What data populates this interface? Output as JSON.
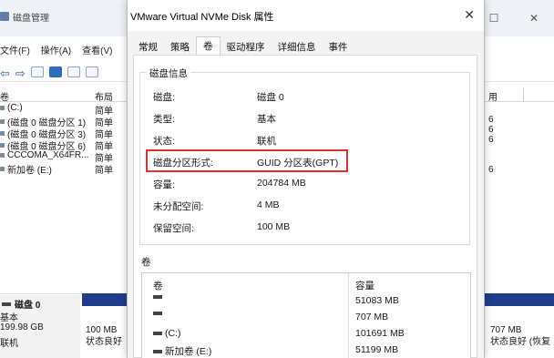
{
  "background_window": {
    "title": "磁盘管理",
    "menu": [
      "文件(F)",
      "操作(A)",
      "查看(V)"
    ],
    "volume_columns": [
      "卷",
      "布局"
    ],
    "volumes": [
      {
        "name": "(C:)",
        "layout": "简单"
      },
      {
        "name": "(磁盘 0 磁盘分区 1)",
        "layout": "简单"
      },
      {
        "name": "(磁盘 0 磁盘分区 3)",
        "layout": "简单"
      },
      {
        "name": "(磁盘 0 磁盘分区 6)",
        "layout": "简单"
      },
      {
        "name": "CCCOMA_X64FR...",
        "layout": "简单"
      },
      {
        "name": "新加卷 (E:)",
        "layout": "简单"
      }
    ],
    "right_column_header": "用",
    "right_column_values": [
      "6",
      "6",
      "6",
      "",
      "",
      "6"
    ],
    "disk": {
      "name": "磁盘 0",
      "type": "基本",
      "size": "199.98 GB",
      "status": "联机"
    },
    "partition_left": {
      "size": "100 MB",
      "status": "状态良好"
    },
    "partition_right": {
      "size": "707 MB",
      "status": "状态良好 (恢复"
    }
  },
  "dialog": {
    "title": "VMware Virtual NVMe Disk 属性",
    "tabs": [
      "常规",
      "策略",
      "卷",
      "驱动程序",
      "详细信息",
      "事件"
    ],
    "active_tab": "卷",
    "disk_info_label": "磁盘信息",
    "disk_info": [
      {
        "key": "磁盘:",
        "value": "磁盘 0"
      },
      {
        "key": "类型:",
        "value": "基本"
      },
      {
        "key": "状态:",
        "value": "联机"
      },
      {
        "key": "磁盘分区形式:",
        "value": "GUID 分区表(GPT)"
      },
      {
        "key": "容量:",
        "value": "204784 MB"
      },
      {
        "key": "未分配空间:",
        "value": "4 MB"
      },
      {
        "key": "保留空间:",
        "value": "100 MB"
      }
    ],
    "volumes_label": "卷",
    "volume_table": {
      "headers": [
        "卷",
        "容量"
      ],
      "rows": [
        {
          "name": "",
          "size": "51083 MB"
        },
        {
          "name": "",
          "size": "707 MB"
        },
        {
          "name": "(C:)",
          "size": "101691 MB"
        },
        {
          "name": "新加卷 (E:)",
          "size": "51199 MB"
        }
      ]
    },
    "highlight_color": "#e03131"
  }
}
